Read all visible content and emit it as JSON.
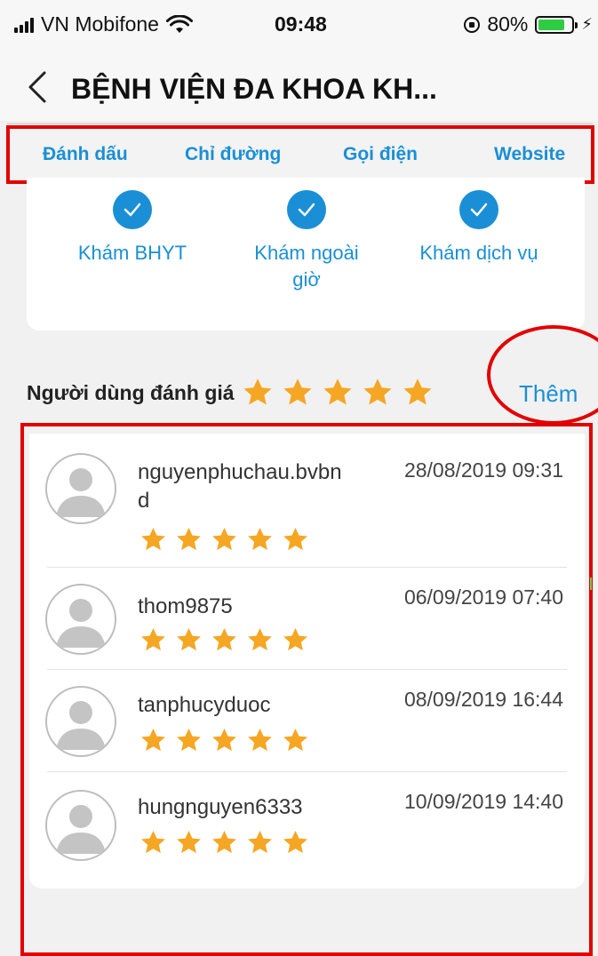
{
  "status_bar": {
    "carrier": "VN Mobifone",
    "time": "09:48",
    "battery_percent": "80%",
    "battery_level": 0.8,
    "battery_color": "#2ecc40"
  },
  "nav": {
    "title": "BỆNH VIỆN ĐA KHOA KH..."
  },
  "actions": {
    "bookmark": "Đánh dấu",
    "directions": "Chỉ đường",
    "call": "Gọi điện",
    "website": "Website"
  },
  "services": [
    {
      "label": "Khám BHYT"
    },
    {
      "label": "Khám ngoài giờ"
    },
    {
      "label": "Khám dịch vụ"
    }
  ],
  "ratings": {
    "title": "Người dùng đánh giá",
    "average_stars": 5,
    "more": "Thêm"
  },
  "reviews": [
    {
      "user": "nguyenphuchau.bvbnd",
      "date": "28/08/2019 09:31",
      "stars": 5
    },
    {
      "user": "thom9875",
      "date": "06/09/2019 07:40",
      "stars": 5
    },
    {
      "user": "tanphucyduoc",
      "date": "08/09/2019 16:44",
      "stars": 5
    },
    {
      "user": "hungnguyen6333",
      "date": "10/09/2019 14:40",
      "stars": 5
    }
  ],
  "colors": {
    "accent": "#1a8fd6",
    "star": "#f5a623",
    "annotation": "#e30000"
  },
  "icons": {
    "back": "chevron-left-icon",
    "check": "check-circle-icon",
    "star": "star-icon",
    "avatar": "user-avatar-icon"
  }
}
